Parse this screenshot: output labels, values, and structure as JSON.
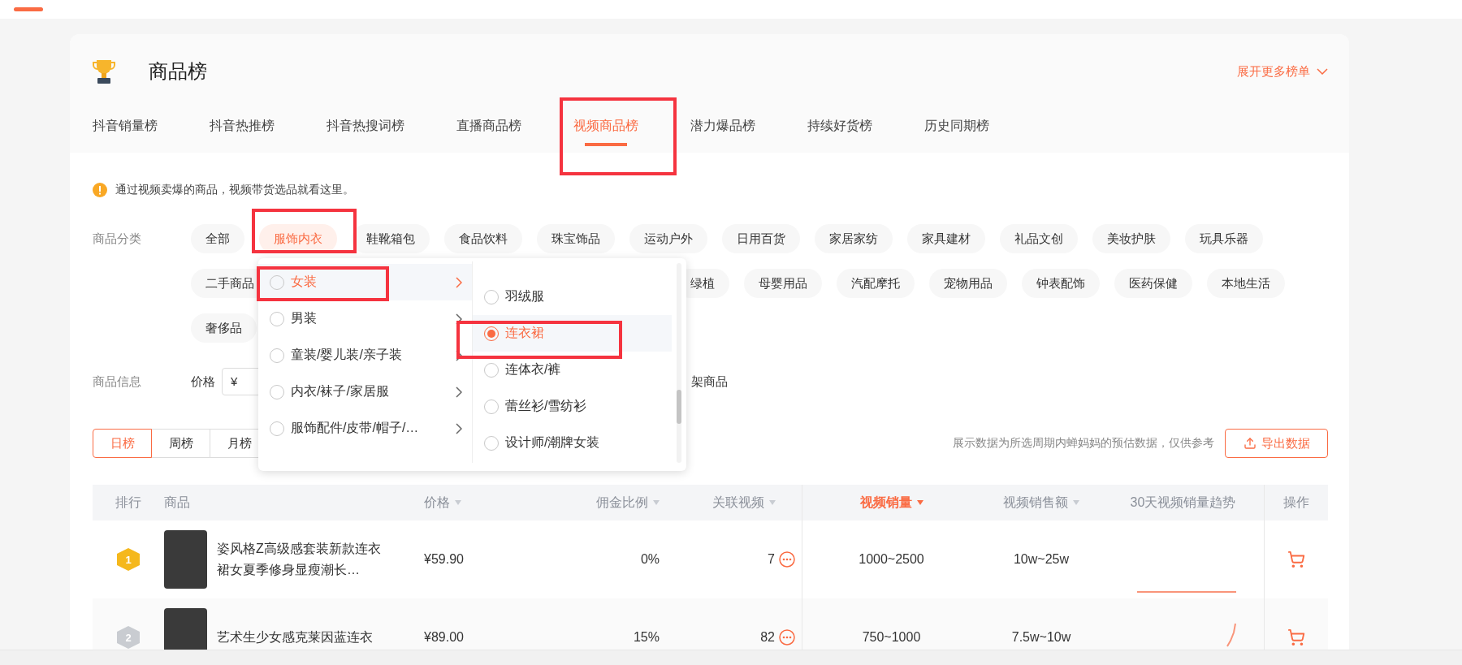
{
  "title": "商品榜",
  "expand_more": "展开更多榜单",
  "tabs": [
    {
      "label": "抖音销量榜",
      "selected": false,
      "highlighted": false
    },
    {
      "label": "抖音热推榜",
      "selected": false,
      "highlighted": false
    },
    {
      "label": "抖音热搜词榜",
      "selected": false,
      "highlighted": false
    },
    {
      "label": "直播商品榜",
      "selected": false,
      "highlighted": false
    },
    {
      "label": "视频商品榜",
      "selected": true,
      "highlighted": true
    },
    {
      "label": "潜力爆品榜",
      "selected": false,
      "highlighted": false
    },
    {
      "label": "持续好货榜",
      "selected": false,
      "highlighted": false
    },
    {
      "label": "历史同期榜",
      "selected": false,
      "highlighted": false
    }
  ],
  "notice": "通过视频卖爆的商品，视频带货选品就看这里。",
  "category": {
    "label": "商品分类",
    "rows": [
      [
        {
          "label": "全部",
          "selected": false,
          "highlighted": false
        },
        {
          "label": "服饰内衣",
          "selected": true,
          "highlighted": true
        },
        {
          "label": "鞋靴箱包",
          "selected": false,
          "highlighted": false
        },
        {
          "label": "食品饮料",
          "selected": false,
          "highlighted": false
        },
        {
          "label": "珠宝饰品",
          "selected": false,
          "highlighted": false
        },
        {
          "label": "运动户外",
          "selected": false,
          "highlighted": false
        },
        {
          "label": "日用百货",
          "selected": false,
          "highlighted": false
        },
        {
          "label": "家居家纺",
          "selected": false,
          "highlighted": false
        },
        {
          "label": "家具建材",
          "selected": false,
          "highlighted": false
        },
        {
          "label": "礼品文创",
          "selected": false,
          "highlighted": false
        },
        {
          "label": "美妆护肤",
          "selected": false,
          "highlighted": false
        },
        {
          "label": "玩具乐器",
          "selected": false,
          "highlighted": false
        }
      ],
      [
        {
          "label": "二手商品",
          "selected": false,
          "highlighted": false
        },
        {
          "label": "绿植",
          "selected": false,
          "highlighted": false,
          "after_menu": true
        },
        {
          "label": "母婴用品",
          "selected": false,
          "highlighted": false
        },
        {
          "label": "汽配摩托",
          "selected": false,
          "highlighted": false
        },
        {
          "label": "宠物用品",
          "selected": false,
          "highlighted": false
        },
        {
          "label": "钟表配饰",
          "selected": false,
          "highlighted": false
        },
        {
          "label": "医药保健",
          "selected": false,
          "highlighted": false
        },
        {
          "label": "本地生活",
          "selected": false,
          "highlighted": false
        }
      ],
      [
        {
          "label": "奢侈品",
          "selected": false,
          "highlighted": false
        }
      ]
    ]
  },
  "info": {
    "label": "商品信息",
    "price_label": "价格",
    "currency": "¥",
    "tail": "架商品"
  },
  "periods": [
    {
      "label": "日榜",
      "selected": true
    },
    {
      "label": "周榜",
      "selected": false
    },
    {
      "label": "月榜",
      "selected": false
    }
  ],
  "data_note": "展示数据为所选周期内蝉妈妈的预估数据，仅供参考",
  "export_button": "导出数据",
  "menu": {
    "left": [
      {
        "label": "女装",
        "expanded": true,
        "checked": false,
        "highlighted": true
      },
      {
        "label": "男装",
        "expanded": false,
        "checked": false,
        "highlighted": false
      },
      {
        "label": "童装/婴儿装/亲子装",
        "expanded": false,
        "checked": false,
        "highlighted": false
      },
      {
        "label": "内衣/袜子/家居服",
        "expanded": false,
        "checked": false,
        "highlighted": false
      },
      {
        "label": "服饰配件/皮带/帽子/…",
        "expanded": false,
        "checked": false,
        "highlighted": false
      }
    ],
    "right": [
      {
        "label": "羽绒服",
        "checked": false,
        "highlighted": false
      },
      {
        "label": "连衣裙",
        "checked": true,
        "highlighted": true
      },
      {
        "label": "连体衣/裤",
        "checked": false,
        "highlighted": false
      },
      {
        "label": "蕾丝衫/雪纺衫",
        "checked": false,
        "highlighted": false
      },
      {
        "label": "设计师/潮牌女装",
        "checked": false,
        "highlighted": false
      }
    ]
  },
  "table": {
    "columns": [
      {
        "label": "排行",
        "sortable": false,
        "active": false
      },
      {
        "label": "商品",
        "sortable": false,
        "active": false
      },
      {
        "label": "价格",
        "sortable": true,
        "active": false
      },
      {
        "label": "佣金比例",
        "sortable": true,
        "active": false
      },
      {
        "label": "关联视频",
        "sortable": true,
        "active": false
      },
      {
        "label": "视频销量",
        "sortable": true,
        "active": true
      },
      {
        "label": "视频销售额",
        "sortable": true,
        "active": false
      },
      {
        "label": "30天视频销量趋势",
        "sortable": false,
        "active": false
      },
      {
        "label": "操作",
        "sortable": false,
        "active": false
      }
    ],
    "rows": [
      {
        "rank": "1",
        "color": "#f5b81c",
        "kind": "flat",
        "name": "姿风格Z高级感套装新款连衣裙女夏季修身显瘦潮长…",
        "price": "¥59.90",
        "commission": "0%",
        "videos": "7",
        "sales": "1000~2500",
        "amount": "10w~25w"
      },
      {
        "rank": "2",
        "color": "#c9ccd1",
        "kind": "spike",
        "name": "艺术生少女感克莱因蓝连衣",
        "price": "¥89.00",
        "commission": "15%",
        "videos": "82",
        "sales": "750~1000",
        "amount": "7.5w~10w"
      }
    ]
  }
}
